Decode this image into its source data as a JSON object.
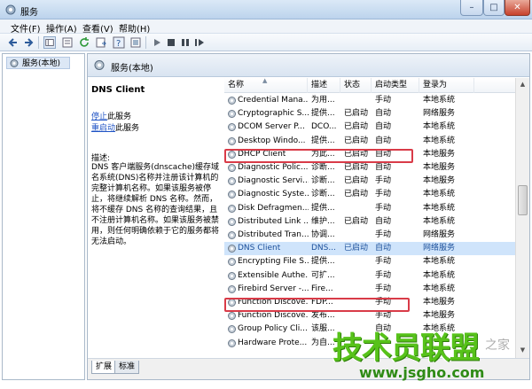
{
  "window": {
    "title": "服务",
    "minimize": "–",
    "maximize": "□",
    "close": "✕"
  },
  "menu": [
    "文件(F)",
    "操作(A)",
    "查看(V)",
    "帮助(H)"
  ],
  "tree": {
    "item": "服务(本地)"
  },
  "main": {
    "header": "服务(本地)",
    "selected_service": "DNS Client",
    "stop_link": "停止",
    "stop_suffix": "此服务",
    "restart_link": "重启动",
    "restart_suffix": "此服务",
    "description_label": "描述:",
    "description": "DNS 客户端服务(dnscache)缓存域名系统(DNS)名称并注册该计算机的完整计算机名称。如果该服务被停止，将继续解析 DNS 名称。然而，将不缓存 DNS 名称的查询结果，且不注册计算机名称。如果该服务被禁用，则任何明确依赖于它的服务都将无法启动。"
  },
  "columns": [
    "名称",
    "描述",
    "状态",
    "启动类型",
    "登录为"
  ],
  "services": [
    {
      "name": "Credential Mana...",
      "desc": "为用...",
      "status": "",
      "startup": "手动",
      "logon": "本地系统"
    },
    {
      "name": "Cryptographic S...",
      "desc": "提供...",
      "status": "已启动",
      "startup": "自动",
      "logon": "网络服务"
    },
    {
      "name": "DCOM Server P...",
      "desc": "DCO...",
      "status": "已启动",
      "startup": "自动",
      "logon": "本地系统"
    },
    {
      "name": "Desktop Windo...",
      "desc": "提供...",
      "status": "已启动",
      "startup": "自动",
      "logon": "本地系统"
    },
    {
      "name": "DHCP Client",
      "desc": "为此...",
      "status": "已启动",
      "startup": "自动",
      "logon": "本地服务"
    },
    {
      "name": "Diagnostic Polic...",
      "desc": "诊断...",
      "status": "已启动",
      "startup": "自动",
      "logon": "本地服务"
    },
    {
      "name": "Diagnostic Servi...",
      "desc": "诊断...",
      "status": "已启动",
      "startup": "手动",
      "logon": "本地服务"
    },
    {
      "name": "Diagnostic Syste...",
      "desc": "诊断...",
      "status": "已启动",
      "startup": "手动",
      "logon": "本地系统"
    },
    {
      "name": "Disk Defragmen...",
      "desc": "提供...",
      "status": "",
      "startup": "手动",
      "logon": "本地系统"
    },
    {
      "name": "Distributed Link ...",
      "desc": "维护...",
      "status": "已启动",
      "startup": "自动",
      "logon": "本地系统"
    },
    {
      "name": "Distributed Tran...",
      "desc": "协调...",
      "status": "",
      "startup": "手动",
      "logon": "网络服务"
    },
    {
      "name": "DNS Client",
      "desc": "DNS...",
      "status": "已启动",
      "startup": "自动",
      "logon": "网络服务"
    },
    {
      "name": "Encrypting File S...",
      "desc": "提供...",
      "status": "",
      "startup": "手动",
      "logon": "本地系统"
    },
    {
      "name": "Extensible Authe...",
      "desc": "可扩...",
      "status": "",
      "startup": "手动",
      "logon": "本地系统"
    },
    {
      "name": "Firebird Server -...",
      "desc": "Fire...",
      "status": "",
      "startup": "手动",
      "logon": "本地系统"
    },
    {
      "name": "Function Discove...",
      "desc": "FDP...",
      "status": "",
      "startup": "手动",
      "logon": "本地服务"
    },
    {
      "name": "Function Discove...",
      "desc": "发布...",
      "status": "",
      "startup": "手动",
      "logon": "本地服务"
    },
    {
      "name": "Group Policy Cli...",
      "desc": "该服...",
      "status": "",
      "startup": "自动",
      "logon": "本地系统"
    },
    {
      "name": "Hardware Prote...",
      "desc": "为自...",
      "status": "",
      "startup": "",
      "logon": ""
    }
  ],
  "tabs": [
    "扩展",
    "标准"
  ],
  "watermark": {
    "text": "技术员联盟",
    "url": "www.jsgho.com",
    "side": "之家"
  },
  "colors": {
    "highlight": "#d93b48",
    "link": "#1f53c5",
    "watermark": "#57c21a"
  }
}
